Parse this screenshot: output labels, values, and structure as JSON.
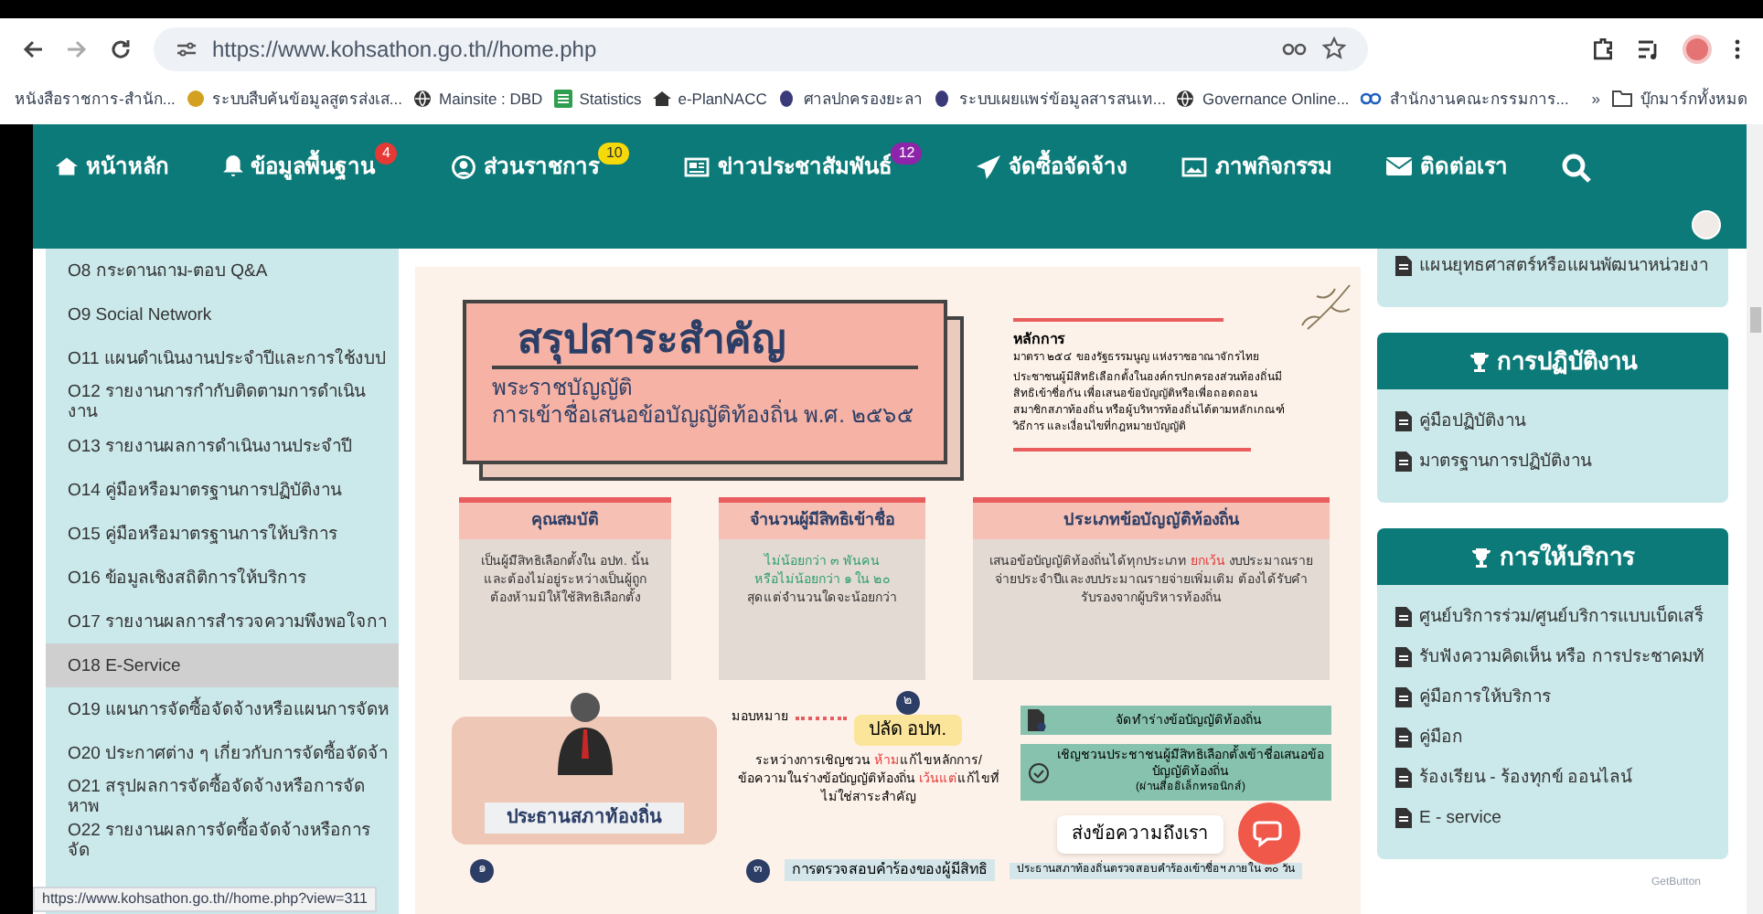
{
  "browser": {
    "url": "https://www.kohsathon.go.th//home.php",
    "bookmarks": [
      {
        "label": "หนังสือราชการ-สำนัก...",
        "kind": "none"
      },
      {
        "label": "ระบบสืบค้นข้อมูลสูตรส่งเส...",
        "kind": "badge"
      },
      {
        "label": "Mainsite : DBD",
        "kind": "globe"
      },
      {
        "label": "Statistics",
        "kind": "sheet"
      },
      {
        "label": "e-PlanNACC",
        "kind": "home"
      },
      {
        "label": "ศาลปกครองยะลา",
        "kind": "emblem"
      },
      {
        "label": "ระบบเผยแพร่ข้อมูลสารสนเท...",
        "kind": "emblem"
      },
      {
        "label": "Governance Online...",
        "kind": "globe"
      },
      {
        "label": "สำนักงานคณะกรรมการ...",
        "kind": "ocs"
      }
    ],
    "more": "»",
    "all_bookmarks": "บุ๊กมาร์กทั้งหมด"
  },
  "nav": [
    {
      "label": "หน้าหลัก",
      "kind": "home"
    },
    {
      "label": "ข้อมูลพื้นฐาน",
      "kind": "bell",
      "badge": "4",
      "color": "#e53935"
    },
    {
      "label": "ส่วนราชการ",
      "kind": "user",
      "badge": "10",
      "color": "#f5d90a"
    },
    {
      "label": "ข่าวประชาสัมพันธ์",
      "kind": "news",
      "badge": "12",
      "color": "#8e24aa"
    },
    {
      "label": "จัดซื้อจัดจ้าง",
      "kind": "plane"
    },
    {
      "label": "ภาพกิจกรรม",
      "kind": "image"
    },
    {
      "label": "ติดต่อเรา",
      "kind": "mail"
    }
  ],
  "sidebar": {
    "items": [
      {
        "label": "O8 กระดานถาม-ตอบ Q&A",
        "selected": false
      },
      {
        "label": "O9 Social Network",
        "selected": false
      },
      {
        "label": "O11 แผนดำเนินงานประจำปีและการใช้งบป",
        "selected": false
      },
      {
        "label": "O12 รายงานการกำกับติดตามการดำเนินงาน",
        "selected": false
      },
      {
        "label": "O13 รายงานผลการดำเนินงานประจำปี",
        "selected": false
      },
      {
        "label": "O14 คู่มือหรือมาตรฐานการปฏิบัติงาน",
        "selected": false
      },
      {
        "label": "O15 คู่มือหรือมาตรฐานการให้บริการ",
        "selected": false
      },
      {
        "label": "O16 ข้อมูลเชิงสถิติการให้บริการ",
        "selected": false
      },
      {
        "label": "O17 รายงานผลการสำรวจความพึงพอใจกา",
        "selected": false
      },
      {
        "label": "O18 E-Service",
        "selected": true
      },
      {
        "label": "O19 แผนการจัดซื้อจัดจ้างหรือแผนการจัดห",
        "selected": false
      },
      {
        "label": "O20 ประกาศต่าง ๆ เกี่ยวกับการจัดซื้อจัดจ้า",
        "selected": false
      },
      {
        "label": "O21 สรุปผลการจัดซื้อจัดจ้างหรือการจัดหาพ",
        "selected": false
      },
      {
        "label": "O22 รายงานผลการจัดซื้อจัดจ้างหรือการจัด",
        "selected": false
      }
    ]
  },
  "infographic": {
    "title": "สรุปสาระสำคัญ",
    "subtitle": [
      "พระราชบัญญัติ",
      "การเข้าชื่อเสนอข้อบัญญัติท้องถิ่น พ.ศ. ๒๕๖๕"
    ],
    "principle": {
      "heading": "หลักการ",
      "source": "มาตรา ๒๕๔ ของรัฐธรรมนูญ แห่งราชอาณาจักรไทย",
      "text": "ประชาชนผู้มีสิทธิเลือกตั้งในองค์กรปกครองส่วนท้องถิ่นมีสิทธิเข้าชื่อกัน เพื่อเสนอข้อบัญญัติหรือเพื่อถอดถอนสมาชิกสภาท้องถิ่น หรือผู้บริหารท้องถิ่นได้ตามหลักเกณฑ์ วิธีการ และเงื่อนไขที่กฎหมายบัญญัติ"
    },
    "boxes": [
      {
        "heading": "คุณสมบัติ",
        "lines": [
          "เป็นผู้มีสิทธิเลือกตั้งใน อปท. นั้น และต้องไม่อยู่ระหว่างเป็นผู้ถูกต้องห้ามมิให้ใช้สิทธิเลือกตั้ง"
        ]
      },
      {
        "heading": "จำนวนผู้มีสิทธิเข้าชื่อ",
        "lines": [
          "ไม่น้อยกว่า ๓ พันคน",
          "หรือไม่น้อยกว่า ๑ ใน ๒๐",
          "สุดแต่จำนวนใดจะน้อยกว่า"
        ]
      },
      {
        "heading": "ประเภทข้อบัญญัติท้องถิ่น",
        "lines": [
          "เสนอข้อบัญญัติท้องถิ่นได้ทุกประเภท **ยกเว้น** งบประมาณรายจ่ายประจำปีและงบประมาณรายจ่ายเพิ่มเติม ต้องได้รับคำรับรองจากผู้บริหารท้องถิ่น"
        ]
      }
    ],
    "chair": "ประธานสภาท้องถิ่น",
    "assign": "มอบหมาย",
    "step2": "๒",
    "clerk": "ปลัด อปท.",
    "rule": "ระหว่างการเชิญชวน **ห้าม**แก้ไขหลักการ/ข้อความในร่างข้อบัญญัติท้องถิ่น **เว้นแต่**แก้ไขที่ไม่ใช่สาระสำคัญ",
    "tasks": [
      {
        "text": "จัดทำร่างข้อบัญญัติท้องถิ่น",
        "kind": "doc"
      },
      {
        "text": "เชิญชวนประชาชนผู้มีสิทธิเลือกตั้งเข้าชื่อเสนอข้อบัญญัติท้องถิ่น",
        "note": "(ผ่านสื่ออิเล็กทรอนิกส์)",
        "kind": "check"
      }
    ],
    "step1": "๑",
    "step3": "๓",
    "verify": "การตรวจสอบคำร้องของผู้มีสิทธิ",
    "verify_note": "ประธานสภาท้องถิ่นตรวจสอบคำร้องเข้าชื่อฯ ภายใน ๓๐ วัน"
  },
  "right_panels": [
    {
      "items": [
        "แผนยุทธศาสตร์หรือแผนพัฒนาหน่วยงา"
      ]
    },
    {
      "title": "การปฏิบัติงาน",
      "items": [
        "คู่มือปฏิบัติงาน",
        "มาตรฐานการปฏิบัติงาน"
      ]
    },
    {
      "title": "การให้บริการ",
      "items": [
        "ศูนย์บริการร่วม/ศูนย์บริการแบบเบ็ดเสร็",
        "รับฟังความคิดเห็น หรือ การประชาคมทั",
        "คู่มือการให้บริการ",
        "คู่มือก",
        "ร้องเรียน - ร้องทุกข์ ออนไลน์",
        "E - service"
      ]
    }
  ],
  "chat": {
    "tooltip": "ส่งข้อความถึงเรา",
    "brand": "GetButton"
  },
  "status_url": "https://www.kohsathon.go.th//home.php?view=311"
}
